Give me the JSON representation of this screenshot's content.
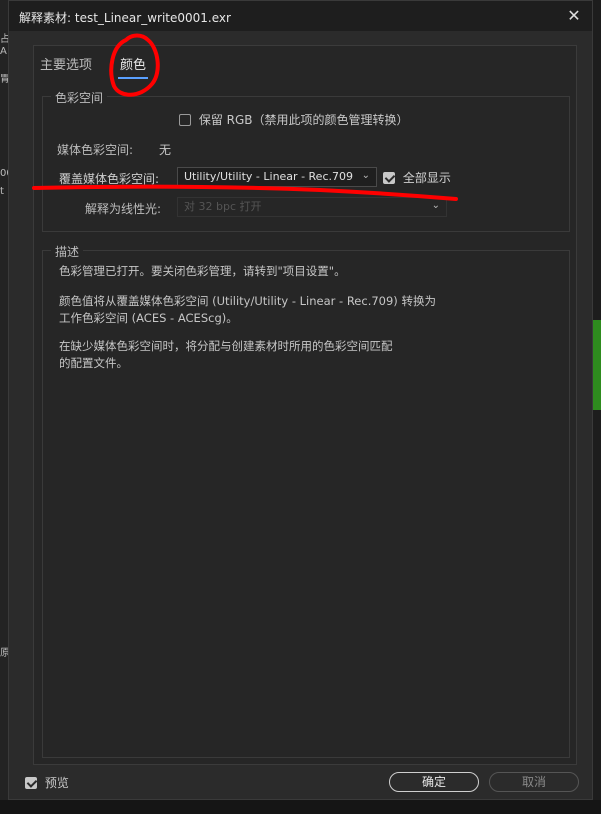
{
  "window": {
    "title": "解释素材: test_Linear_write0001.exr",
    "close_glyph": "✕"
  },
  "background": {
    "fragments": [
      "占",
      "A",
      "胃",
      "00",
      "t",
      "原"
    ]
  },
  "tabs": [
    {
      "label": "主要选项",
      "active": false
    },
    {
      "label": "颜色",
      "active": true
    }
  ],
  "color_space": {
    "legend": "色彩空间",
    "preserve_rgb_label": "保留 RGB（禁用此项的颜色管理转换）",
    "preserve_rgb_checked": false,
    "media_color_space_label": "媒体色彩空间:",
    "media_color_space_value": "无",
    "override_label": "覆盖媒体色彩空间:",
    "override_value": "Utility/Utility - Linear - Rec.709",
    "show_all_label": "全部显示",
    "show_all_checked": true,
    "interpret_linear_label": "解释为线性光:",
    "interpret_linear_value": "对 32 bpc 打开"
  },
  "description": {
    "legend": "描述",
    "lines": [
      "色彩管理已打开。要关闭色彩管理，请转到\"项目设置\"。",
      "颜色值将从覆盖媒体色彩空间 (Utility/Utility - Linear - Rec.709) 转换为",
      "工作色彩空间 (ACES - ACEScg)。",
      "在缺少媒体色彩空间时，将分配与创建素材时所用的色彩空间匹配",
      "的配置文件。"
    ]
  },
  "footer": {
    "preview_label": "预览",
    "preview_checked": true,
    "ok_label": "确定",
    "cancel_label": "取消"
  },
  "colors": {
    "dialog_bg": "#2b2b2b",
    "accent": "#5aa0ff",
    "annotation_red": "#ff0000"
  }
}
